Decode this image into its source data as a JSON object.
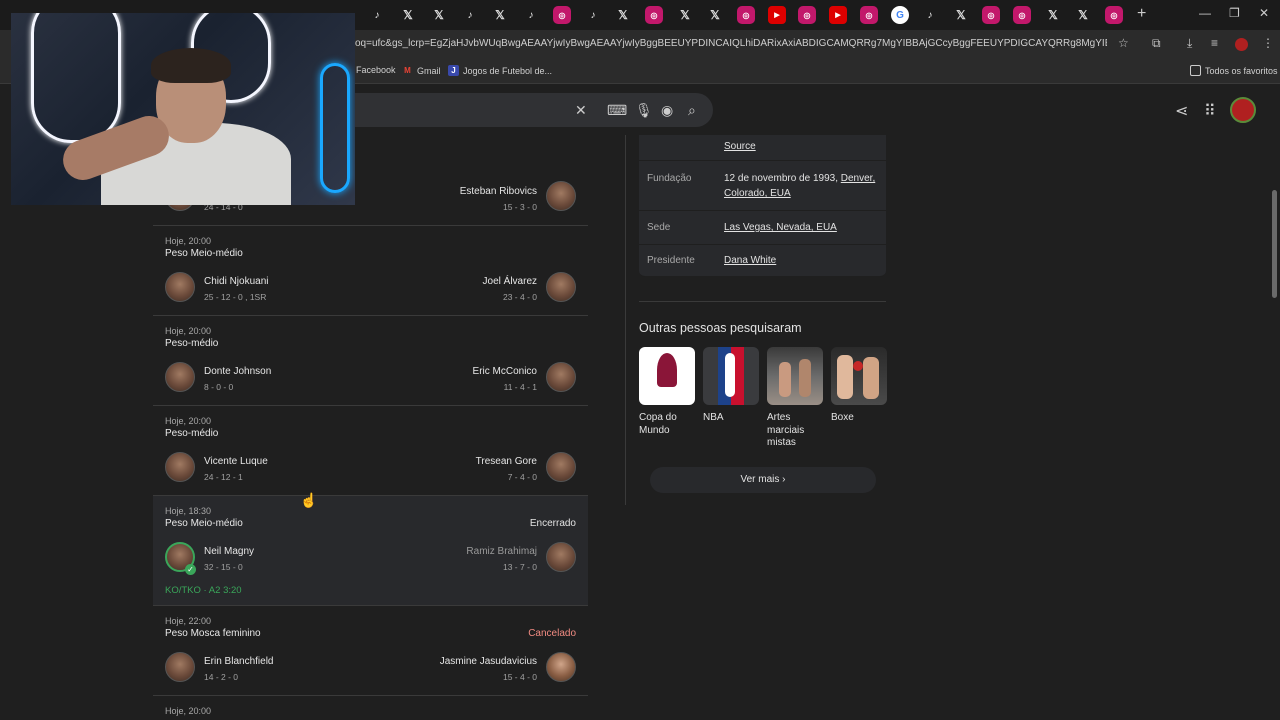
{
  "browser": {
    "url": "oq=ufc&gs_lcrp=EgZjaHJvbWUqBwgAEAAYjwIyBwgAEAAYjwIyBggBEEUYPDINCAIQLhiDARixAxiABDIGCAMQRRg7MgYIBBAjGCcyBggFEEUYPDIGCAYQRRg8MgYIBxBFGDzSAQgxNzQ...",
    "bookmarks": [
      {
        "label": "Facebook"
      },
      {
        "label": "Gmail"
      },
      {
        "label": "Jogos de Futebol de..."
      }
    ],
    "all_bookmarks_label": "Todos os favoritos"
  },
  "fights": [
    {
      "time": "",
      "weight_class": "",
      "status": "",
      "fighter1": {
        "name": "",
        "record": "24 - 14 - 0"
      },
      "fighter2": {
        "name": "Esteban Ribovics",
        "record": "15 - 3 - 0"
      }
    },
    {
      "time": "Hoje, 20:00",
      "weight_class": "Peso Meio-médio",
      "status": "",
      "fighter1": {
        "name": "Chidi Njokuani",
        "record": "25 - 12 - 0 , 1SR"
      },
      "fighter2": {
        "name": "Joel Álvarez",
        "record": "23 - 4 - 0"
      }
    },
    {
      "time": "Hoje, 20:00",
      "weight_class": "Peso-médio",
      "status": "",
      "fighter1": {
        "name": "Donte Johnson",
        "record": "8 - 0 - 0"
      },
      "fighter2": {
        "name": "Eric McConico",
        "record": "11 - 4 - 1"
      }
    },
    {
      "time": "Hoje, 20:00",
      "weight_class": "Peso-médio",
      "status": "",
      "fighter1": {
        "name": "Vicente Luque",
        "record": "24 - 12 - 1"
      },
      "fighter2": {
        "name": "Tresean Gore",
        "record": "7 - 4 - 0"
      }
    },
    {
      "time": "Hoje, 18:30",
      "weight_class": "Peso Meio-médio",
      "status": "Encerrado",
      "fighter1": {
        "name": "Neil Magny",
        "record": "32 - 15 - 0"
      },
      "fighter2": {
        "name": "Ramiz Brahimaj",
        "record": "13 - 7 - 0"
      },
      "result": "KO/TKO · A2 3:20"
    },
    {
      "time": "Hoje, 22:00",
      "weight_class": "Peso Mosca feminino",
      "status": "Cancelado",
      "fighter1": {
        "name": "Erin Blanchfield",
        "record": "14 - 2 - 0"
      },
      "fighter2": {
        "name": "Jasmine Jasudavicius",
        "record": "15 - 4 - 0"
      }
    },
    {
      "time": "Hoje, 20:00",
      "weight_class": "",
      "status": "",
      "fighter1": {
        "name": "",
        "record": ""
      },
      "fighter2": {
        "name": "",
        "record": ""
      }
    }
  ],
  "knowledge_panel": {
    "source_label": "Source",
    "founded_label": "Fundação",
    "founded_value_prefix": "12 de novembro de 1993,",
    "founded_link1": "Denver,",
    "founded_link2": "Colorado, EUA",
    "hq_label": "Sede",
    "hq_value": "Las Vegas, Nevada, EUA",
    "president_label": "Presidente",
    "president_value": "Dana White"
  },
  "people_also_search": {
    "title": "Outras pessoas pesquisaram",
    "items": [
      {
        "label": "Copa do Mundo"
      },
      {
        "label": "NBA"
      },
      {
        "label": "Artes marciais mistas"
      },
      {
        "label": "Boxe"
      }
    ],
    "more_label": "Ver mais"
  },
  "colors": {
    "win": "#3aa65a",
    "status_ended": "#e3e3e3",
    "status_cancelled": "#f28b82"
  }
}
